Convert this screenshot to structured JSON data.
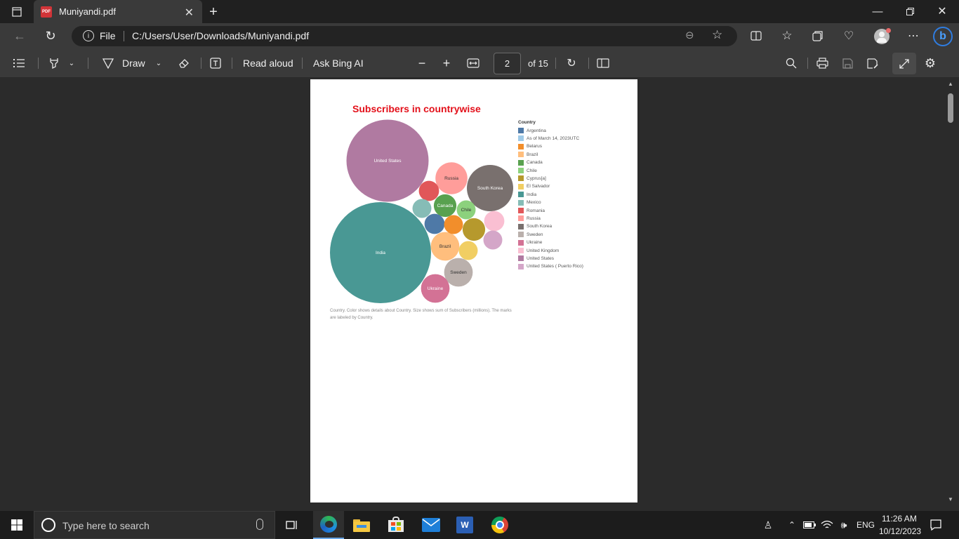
{
  "browser": {
    "tab_title": "Muniyandi.pdf",
    "address_prefix": "File",
    "address": "C:/Users/User/Downloads/Muniyandi.pdf"
  },
  "pdf_toolbar": {
    "draw_label": "Draw",
    "read_aloud_label": "Read aloud",
    "ask_bing_label": "Ask Bing AI",
    "page_number": "2",
    "page_total": "of 15"
  },
  "chart_data": {
    "type": "bubble",
    "title": "Subscribers in countrywise",
    "legend_title": "Country",
    "legend_placement": "right",
    "legend": [
      {
        "name": "Argentina",
        "color": "#4e79a7"
      },
      {
        "name": "As of March 14, 2023UTC",
        "color": "#a0cbe8"
      },
      {
        "name": "Belarus",
        "color": "#f28e2b"
      },
      {
        "name": "Brazil",
        "color": "#ffbe7d"
      },
      {
        "name": "Canada",
        "color": "#59a14f"
      },
      {
        "name": "Chile",
        "color": "#8cd17d"
      },
      {
        "name": "Cyprus[a]",
        "color": "#b6992d"
      },
      {
        "name": "El Salvador",
        "color": "#f1ce63"
      },
      {
        "name": "India",
        "color": "#499894"
      },
      {
        "name": "Mexico",
        "color": "#86bcb6"
      },
      {
        "name": "Romania",
        "color": "#e15759"
      },
      {
        "name": "Russia",
        "color": "#ff9d9a"
      },
      {
        "name": "South Korea",
        "color": "#79706e"
      },
      {
        "name": "Sweden",
        "color": "#bab0ac"
      },
      {
        "name": "Ukraine",
        "color": "#d37295"
      },
      {
        "name": "United Kingdom",
        "color": "#fabfd2"
      },
      {
        "name": "United States",
        "color": "#b07aa1"
      },
      {
        "name": "United States ( Puerto Rico)",
        "color": "#d4a6c8"
      }
    ],
    "bubbles": [
      {
        "country": "India",
        "label": "India",
        "value": 100,
        "color": "#499894",
        "label_color": "#ffffff"
      },
      {
        "country": "United States",
        "label": "United States",
        "value": 66,
        "color": "#b07aa1",
        "label_color": "#ffffff"
      },
      {
        "country": "South Korea",
        "label": "South Korea",
        "value": 21,
        "color": "#79706e",
        "label_color": "#ffffff"
      },
      {
        "country": "Russia",
        "label": "Russia",
        "value": 10,
        "color": "#ff9d9a",
        "label_color": "#333333"
      },
      {
        "country": "Brazil",
        "label": "Brazil",
        "value": 8,
        "color": "#ffbe7d",
        "label_color": "#333333"
      },
      {
        "country": "Sweden",
        "label": "Sweden",
        "value": 8,
        "color": "#bab0ac",
        "label_color": "#333333"
      },
      {
        "country": "Ukraine",
        "label": "Ukraine",
        "value": 8,
        "color": "#d37295",
        "label_color": "#ffffff"
      },
      {
        "country": "Canada",
        "label": "Canada",
        "value": 5,
        "color": "#59a14f",
        "label_color": "#ffffff"
      },
      {
        "country": "Cyprus[a]",
        "label": "",
        "value": 5,
        "color": "#b6992d",
        "label_color": "#ffffff"
      },
      {
        "country": "Romania",
        "label": "",
        "value": 4,
        "color": "#e15759",
        "label_color": "#ffffff"
      },
      {
        "country": "Argentina",
        "label": "",
        "value": 4,
        "color": "#4e79a7",
        "label_color": "#ffffff"
      },
      {
        "country": "United Kingdom",
        "label": "",
        "value": 4,
        "color": "#fabfd2",
        "label_color": "#333333"
      },
      {
        "country": "Chile",
        "label": "Chile",
        "value": 3.5,
        "color": "#8cd17d",
        "label_color": "#333333"
      },
      {
        "country": "Mexico",
        "label": "",
        "value": 3.5,
        "color": "#86bcb6",
        "label_color": "#333333"
      },
      {
        "country": "Belarus",
        "label": "",
        "value": 3.5,
        "color": "#f28e2b",
        "label_color": "#333333"
      },
      {
        "country": "El Salvador",
        "label": "",
        "value": 3.5,
        "color": "#f1ce63",
        "label_color": "#333333"
      },
      {
        "country": "United States ( Puerto Rico)",
        "label": "",
        "value": 3.5,
        "color": "#d4a6c8",
        "label_color": "#333333"
      }
    ],
    "caption": "Country.  Color shows details about Country.  Size shows sum of Subscribers (millions).  The marks are labeled by Country."
  },
  "taskbar": {
    "search_placeholder": "Type here to search",
    "language": "ENG",
    "time": "11:26 AM",
    "date": "10/12/2023"
  }
}
